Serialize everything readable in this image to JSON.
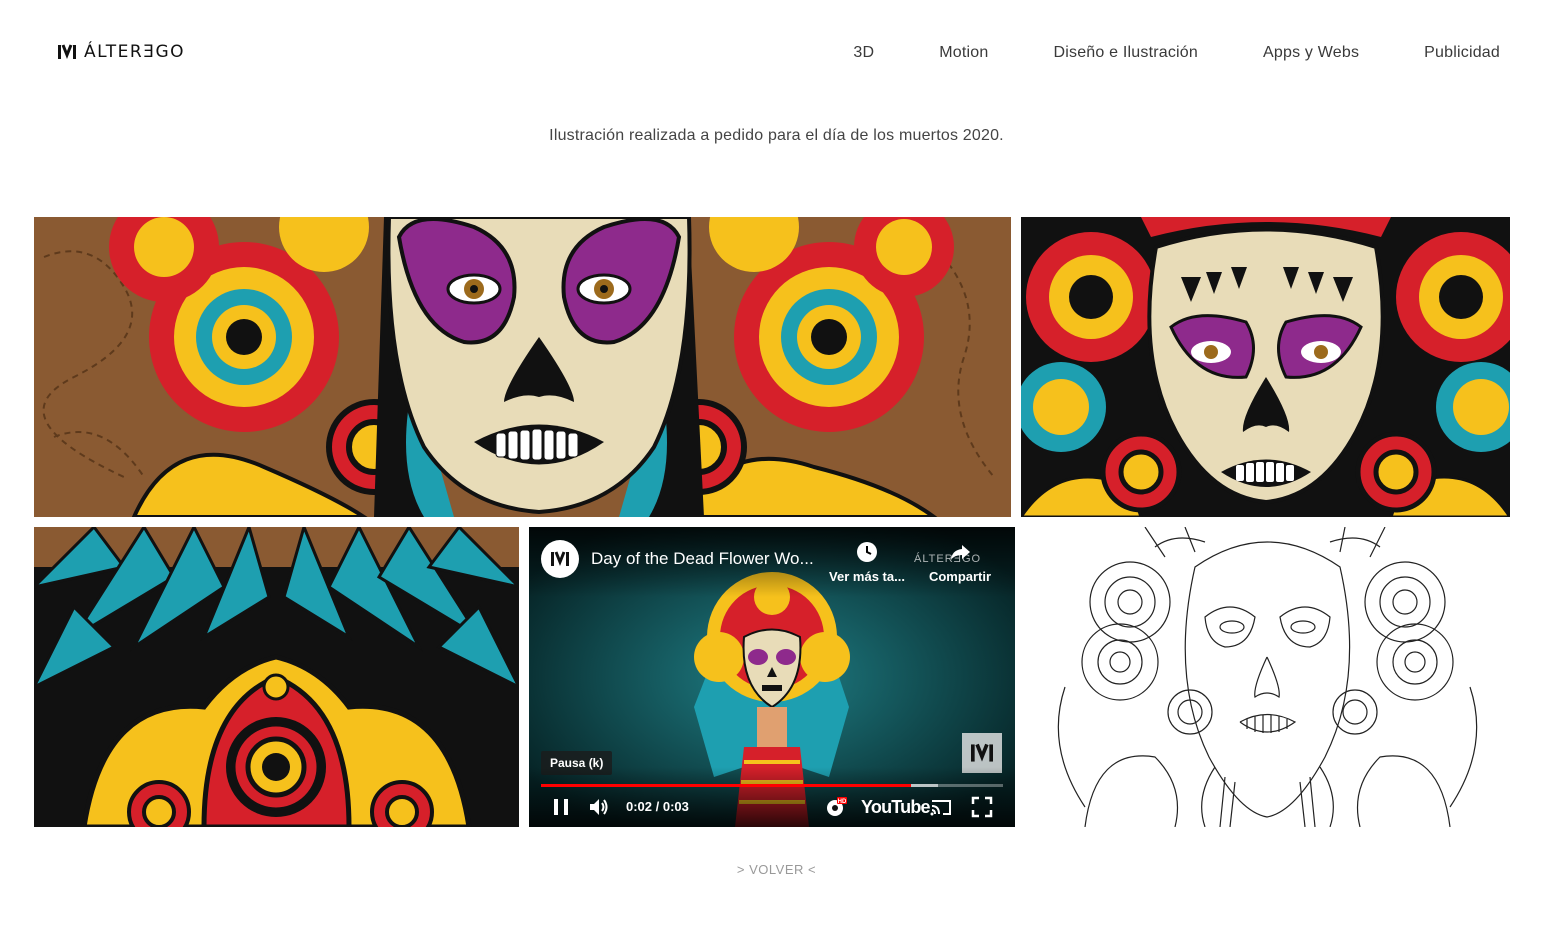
{
  "brand": {
    "name": "ÁLTERƎGO"
  },
  "nav": {
    "items": [
      {
        "label": "3D"
      },
      {
        "label": "Motion"
      },
      {
        "label": "Diseño e Ilustración"
      },
      {
        "label": "Apps y Webs"
      },
      {
        "label": "Publicidad"
      }
    ]
  },
  "project": {
    "description": "Ilustración realizada a pedido para el día de los muertos 2020."
  },
  "gallery": {
    "images": [
      {
        "icon": "catrina-wide-illustration"
      },
      {
        "icon": "catrina-face-crop-illustration"
      },
      {
        "icon": "headdress-detail-illustration"
      },
      {
        "icon": "line-art-sketch"
      }
    ]
  },
  "video": {
    "title": "Day of the Dead Flower Wo...",
    "watch_later_label": "Ver más ta...",
    "share_label": "Compartir",
    "watermark": "ÁLTERƎGO",
    "tooltip": "Pausa (k)",
    "time": "0:02 / 0:03",
    "progress_fraction": 0.8,
    "buffered_fraction": 0.86,
    "platform": "YouTube",
    "hd_badge": "HD"
  },
  "footer": {
    "back_label": "> VOLVER <"
  },
  "colors": {
    "accent_red": "#ff0000",
    "purple": "#8e2a8c",
    "skull": "#e8dcb8",
    "teal": "#1e9fb0",
    "yellow": "#f6c11c",
    "red": "#d6202a",
    "background_brown": "#8a5a32"
  }
}
